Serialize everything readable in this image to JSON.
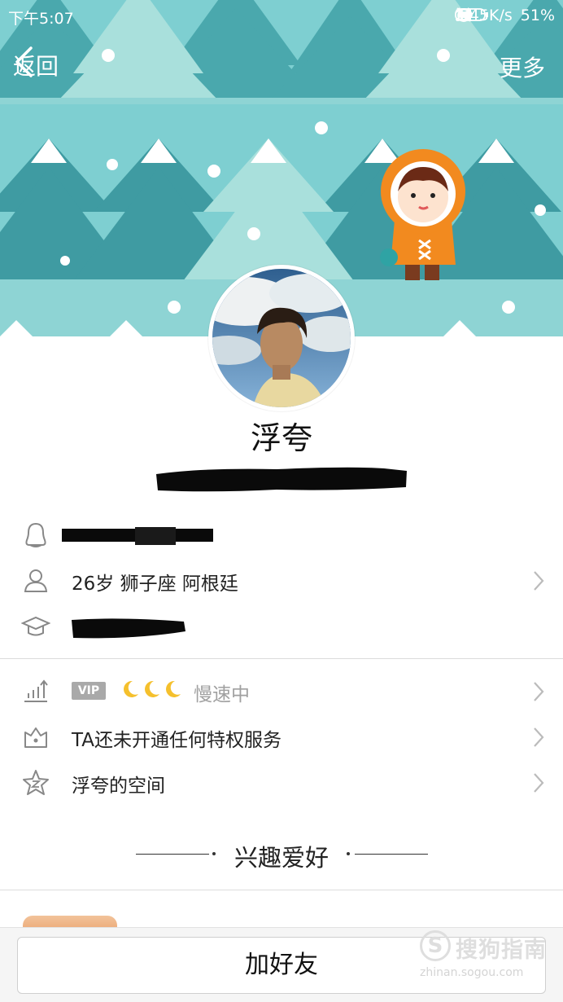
{
  "status_bar": {
    "time": "下午5:07",
    "network_speed": "3.45K/s",
    "battery": "51%"
  },
  "nav": {
    "back_label": "返回",
    "more_label": "更多"
  },
  "profile": {
    "name": "浮夸"
  },
  "info": {
    "basic": "26岁  狮子座  阿根廷"
  },
  "vip": {
    "tag": "VIP",
    "status": "慢速中"
  },
  "privilege": {
    "label": "TA还未开通任何特权服务"
  },
  "qzone": {
    "label": "浮夸的空间"
  },
  "hobbies": {
    "title": "兴趣爱好"
  },
  "actions": {
    "add_friend": "加好友"
  },
  "watermark": {
    "logo_letter": "S",
    "text": "搜狗指南",
    "url": "zhinan.sogou.com"
  },
  "colors": {
    "banner_bg": "#7ecfd1",
    "tree_dark": "#3f9ba2",
    "tree_light": "#a9e0dc",
    "snow": "#ffffff",
    "eskimo_coat": "#f28a1f",
    "moon": "#f5c02d",
    "vip_tag": "#a9a9a9"
  }
}
